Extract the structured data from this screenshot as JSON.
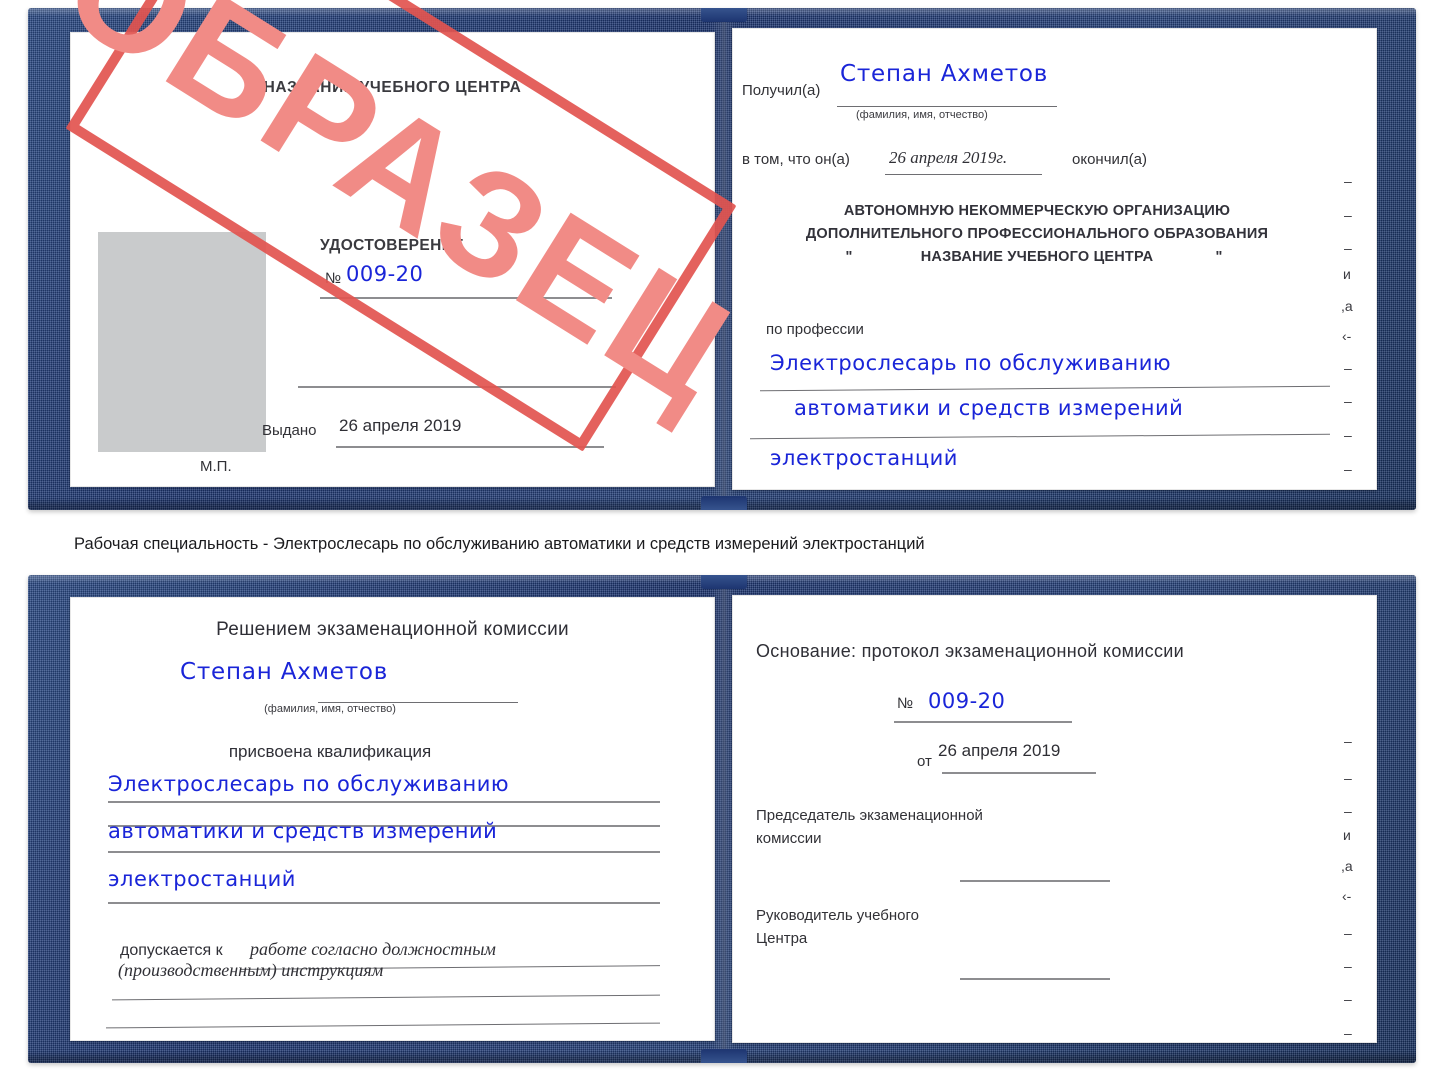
{
  "document": {
    "type": "certificate-scan",
    "watermark_text": "ОБРАЗЕЦ",
    "colors": {
      "cover_blue": "#1d3570",
      "handwriting_blue": "#1a25d8",
      "stamp_red_frame": "#e2544f",
      "stamp_red_text": "#f18b86",
      "photo_placeholder_gray": "#c9cbcc"
    }
  },
  "caption": {
    "text": "Рабочая специальность - Электрослесарь по обслуживанию автоматики и средств измерений электростанций"
  },
  "certificate_top": {
    "left_page": {
      "header": "НАЗВАНИЕ УЧЕБНОГО ЦЕНТРА",
      "doc_type": "УДОСТОВЕРЕНИЕ",
      "number_label": "№",
      "number_value": "009-20",
      "issued_label": "Выдано",
      "issued_value": "26 апреля 2019",
      "seal_label": "М.П.",
      "photo_placeholder": ""
    },
    "right_page": {
      "received_label": "Получил(а)",
      "received_value": "Степан Ахметов",
      "name_hint": "(фамилия, имя, отчество)",
      "in_that_label": "в том, что он(а)",
      "completion_date": "26 апреля 2019г.",
      "finished_label": "окончил(а)",
      "org_line1": "АВТОНОМНУЮ НЕКОММЕРЧЕСКУЮ ОРГАНИЗАЦИЮ",
      "org_line2": "ДОПОЛНИТЕЛЬНОГО ПРОФЕССИОНАЛЬНОГО ОБРАЗОВАНИЯ",
      "org_line3_quote_open": "\"",
      "org_line3": "НАЗВАНИЕ УЧЕБНОГО ЦЕНТРА",
      "org_line3_quote_close": "\"",
      "profession_label": "по профессии",
      "profession_line1": "Электрослесарь по обслуживанию",
      "profession_line2": "автоматики и средств измерений",
      "profession_line3": "электростанций",
      "edge_fragments": [
        "–",
        "–",
        "–",
        "и",
        ",а",
        "‹-",
        "–",
        "–",
        "–",
        "–"
      ]
    }
  },
  "certificate_bottom": {
    "left_page": {
      "header": "Решением экзаменационной комиссии",
      "name_value": "Степан Ахметов",
      "name_hint": "(фамилия, имя, отчество)",
      "qualification_label": "присвоена квалификация",
      "qualification_line1": "Электрослесарь по обслуживанию",
      "qualification_line2": "автоматики и средств измерений",
      "qualification_line3": "электростанций",
      "admitted_label": "допускается к",
      "admitted_value_line1": "работе согласно должностным",
      "admitted_value_line2": "(производственным) инструкциям"
    },
    "right_page": {
      "basis_label": "Основание: протокол экзаменационной комиссии",
      "number_label": "№",
      "number_value": "009-20",
      "date_label": "от",
      "date_value": "26 апреля 2019",
      "chairman_line1": "Председатель экзаменационной",
      "chairman_line2": "комиссии",
      "director_line1": "Руководитель учебного",
      "director_line2": "Центра",
      "edge_fragments": [
        "–",
        "–",
        "–",
        "и",
        ",а",
        "‹-",
        "–",
        "–",
        "–",
        "–"
      ]
    }
  }
}
